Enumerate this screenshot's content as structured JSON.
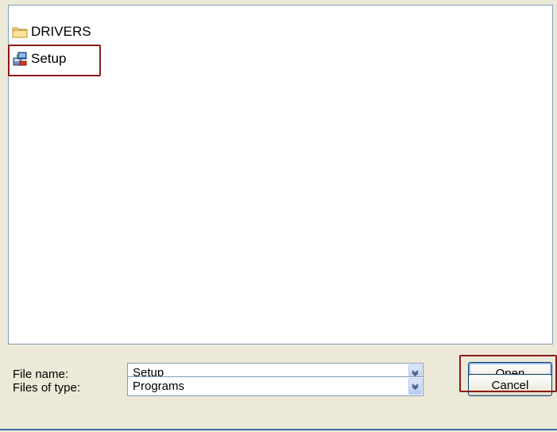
{
  "file_list": {
    "items": [
      {
        "label": "DRIVERS",
        "icon": "folder-icon"
      },
      {
        "label": "Setup",
        "icon": "setup-program-icon"
      }
    ]
  },
  "form": {
    "file_name_label": "File name:",
    "file_name_value": "Setup",
    "file_type_label": "Files of type:",
    "file_type_value": "Programs"
  },
  "buttons": {
    "open_label": "Open",
    "cancel_label": "Cancel"
  },
  "colors": {
    "highlight": "#8b1a1a",
    "dialog_background": "#ece9d8",
    "field_border": "#7f9db9"
  }
}
